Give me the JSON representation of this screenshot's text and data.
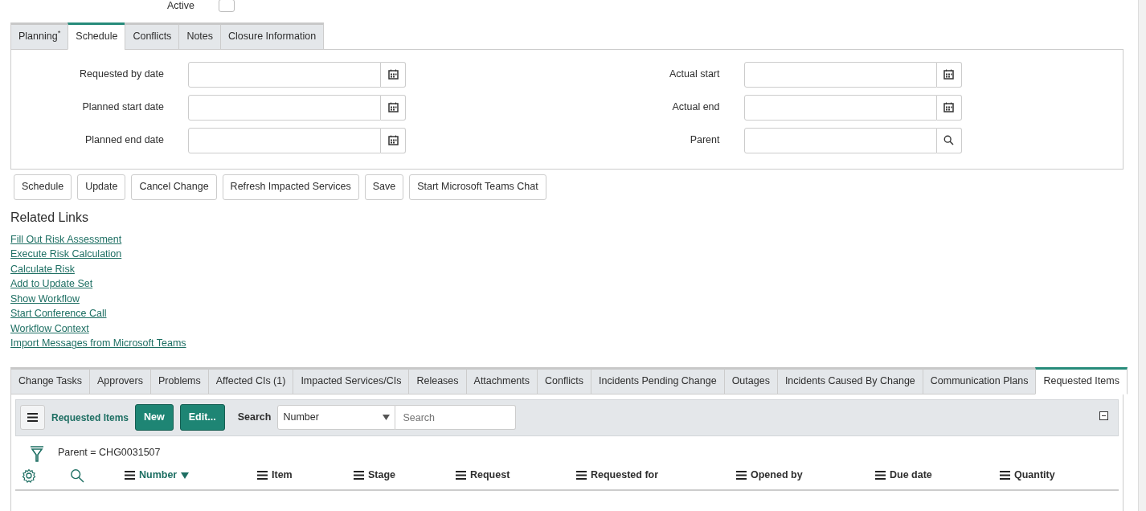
{
  "top_field": {
    "label": "Active"
  },
  "form_tabs": [
    {
      "label": "Planning$^{*}$",
      "selected": false
    },
    {
      "label": "Schedule",
      "selected": true
    },
    {
      "label": "Conflicts",
      "selected": false
    },
    {
      "label": "Notes",
      "selected": false
    },
    {
      "label": "Closure Information",
      "selected": false
    }
  ],
  "fields_left": [
    {
      "label": "Requested by date",
      "kind": "date"
    },
    {
      "label": "Planned start date",
      "kind": "date"
    },
    {
      "label": "Planned end date",
      "kind": "date"
    }
  ],
  "fields_right": [
    {
      "label": "Actual start",
      "kind": "date"
    },
    {
      "label": "Actual end",
      "kind": "date"
    },
    {
      "label": "Parent",
      "kind": "reference"
    }
  ],
  "buttons": [
    "Schedule",
    "Update",
    "Cancel Change",
    "Refresh Impacted Services",
    "Save",
    "Start Microsoft Teams Chat"
  ],
  "related_links": {
    "title": "Related Links",
    "links": [
      "Fill Out Risk Assessment",
      "Execute Risk Calculation",
      "Calculate Risk",
      "Add to Update Set",
      "Show Workflow",
      "Start Conference Call",
      "Workflow Context",
      "Import Messages from Microsoft Teams"
    ]
  },
  "list_tabs": [
    {
      "label": "Change Tasks",
      "selected": false
    },
    {
      "label": "Approvers",
      "selected": false
    },
    {
      "label": "Problems",
      "selected": false
    },
    {
      "label": "Affected CIs (1)",
      "selected": false
    },
    {
      "label": "Impacted Services/CIs",
      "selected": false
    },
    {
      "label": "Releases",
      "selected": false
    },
    {
      "label": "Attachments",
      "selected": false
    },
    {
      "label": "Conflicts",
      "selected": false
    },
    {
      "label": "Incidents Pending Change",
      "selected": false
    },
    {
      "label": "Outages",
      "selected": false
    },
    {
      "label": "Incidents Caused By Change",
      "selected": false
    },
    {
      "label": "Communication Plans",
      "selected": false
    },
    {
      "label": "Requested Items",
      "selected": true
    }
  ],
  "list": {
    "title": "Requested Items",
    "new_button": "New",
    "edit_button": "Edit...",
    "search_label": "Search",
    "search_field": {
      "value": "Number"
    },
    "search_input": {
      "placeholder": "Search"
    },
    "filter": "Parent = CHG0031507",
    "columns": [
      {
        "label": "Number",
        "sorted": true
      },
      {
        "label": "Item",
        "sorted": false
      },
      {
        "label": "Stage",
        "sorted": false
      },
      {
        "label": "Request",
        "sorted": false
      },
      {
        "label": "Requested for",
        "sorted": false
      },
      {
        "label": "Opened by",
        "sorted": false
      },
      {
        "label": "Due date",
        "sorted": false
      },
      {
        "label": "Quantity",
        "sorted": false
      }
    ]
  }
}
